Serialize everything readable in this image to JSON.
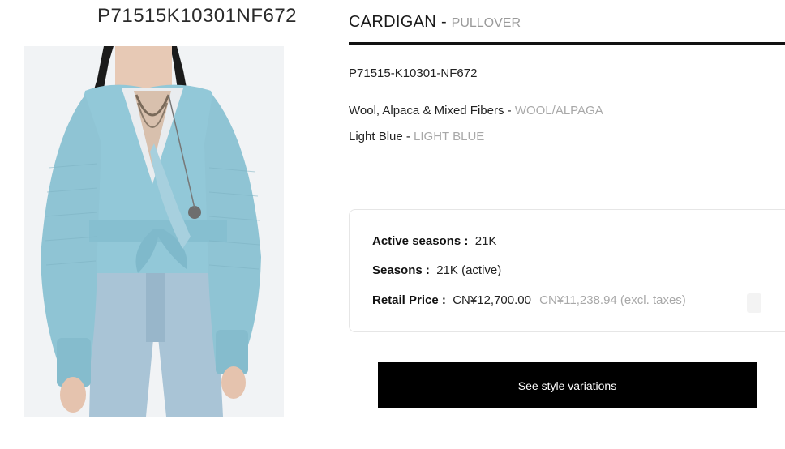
{
  "product_code_heading": "P71515K10301NF672",
  "title": {
    "main": "CARDIGAN",
    "separator": "-",
    "sub": "PULLOVER"
  },
  "reference": "P71515-K10301-NF672",
  "material": {
    "label": "Wool, Alpaca & Mixed Fibers - ",
    "code": "WOOL/ALPAGA"
  },
  "color": {
    "label": "Light Blue - ",
    "code": "LIGHT BLUE"
  },
  "info": {
    "active_seasons_label": "Active seasons :",
    "active_seasons_value": "21K",
    "seasons_label": "Seasons :",
    "seasons_value": "21K (active)",
    "retail_price_label": "Retail Price :",
    "retail_price_value": "CN¥12,700.00",
    "retail_price_excl": "CN¥11,238.94 (excl. taxes)"
  },
  "button": {
    "variations_label": "See style variations"
  }
}
